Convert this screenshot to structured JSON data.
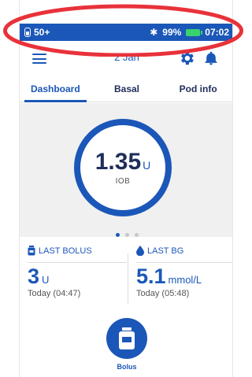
{
  "status_bar": {
    "pod_reservoir": "50+",
    "battery_percent": "99%",
    "clock": "07:02"
  },
  "header": {
    "date": "2 Jan"
  },
  "tabs": [
    {
      "label": "Dashboard",
      "active": true
    },
    {
      "label": "Basal",
      "active": false
    },
    {
      "label": "Pod info",
      "active": false
    }
  ],
  "iob": {
    "value": "1.35",
    "unit": "U",
    "label": "IOB"
  },
  "pager": {
    "count": 3,
    "active_index": 0
  },
  "last_bolus": {
    "title": "LAST BOLUS",
    "value": "3",
    "unit": "U",
    "time": "Today (04:47)"
  },
  "last_bg": {
    "title": "LAST BG",
    "value": "5.1",
    "unit": "mmol/L",
    "time": "Today (05:48)"
  },
  "bolus_button": {
    "label": "Bolus"
  },
  "colors": {
    "primary": "#1b57b8",
    "annotation": "#e8323a",
    "battery": "#3ad16f"
  }
}
